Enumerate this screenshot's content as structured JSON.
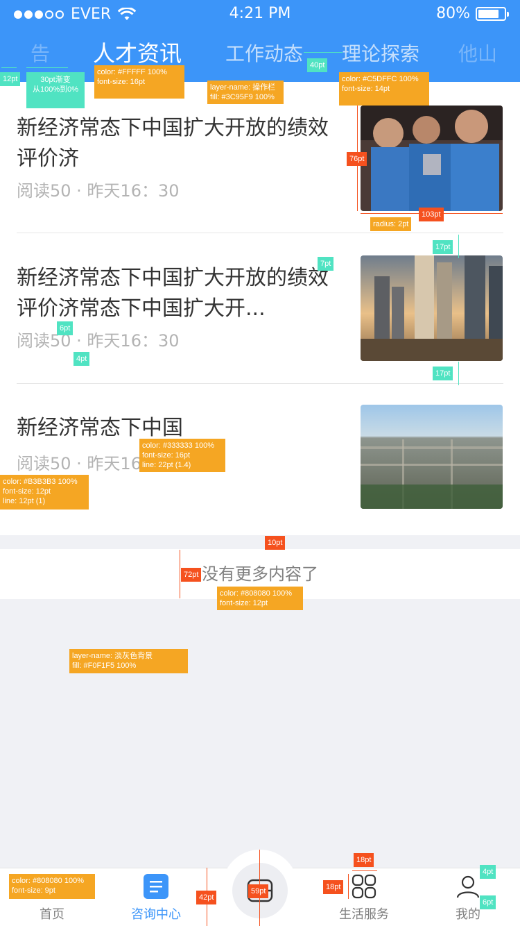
{
  "status_bar": {
    "carrier": "EVER",
    "time": "4:21 PM",
    "battery": "80%",
    "battery_level": 0.8
  },
  "tabs": [
    {
      "label": "告",
      "state": "partial"
    },
    {
      "label": "人才资讯",
      "state": "active"
    },
    {
      "label": "工作动态",
      "state": "normal"
    },
    {
      "label": "理论探索",
      "state": "normal"
    },
    {
      "label": "他山",
      "state": "partial"
    }
  ],
  "articles": [
    {
      "title": "新经济常态下中国扩大开放的绩效评价济",
      "meta": "阅读50 · 昨天16：30",
      "image": "basketball-photo"
    },
    {
      "title": "新经济常态下中国扩大开放的绩效评价济常态下中国扩大开...",
      "meta": "阅读50 · 昨天16：30",
      "image": "skyscraper-photo"
    },
    {
      "title": "新经济常态下中国",
      "meta": "阅读50 · 昨天16：30",
      "image": "city-aerial-photo"
    }
  ],
  "no_more_text": "没有更多内容了",
  "tabbar": {
    "items": [
      {
        "label": "首页",
        "icon": "home-icon",
        "active": false
      },
      {
        "label": "咨询中心",
        "icon": "list-icon",
        "active": true
      },
      {
        "label": "",
        "icon": "center-action-icon",
        "active": false
      },
      {
        "label": "生活服务",
        "icon": "grid-icon",
        "active": false
      },
      {
        "label": "我的",
        "icon": "user-icon",
        "active": false
      }
    ]
  },
  "colors": {
    "primary": "#3C95F9",
    "tab_inactive": "#C5DFFC",
    "title_text": "#333333",
    "meta_text": "#B3B3B3",
    "muted_text": "#808080",
    "page_bg": "#F0F1F5"
  },
  "annotations": {
    "a1": "12pt",
    "a2": "30pt渐变",
    "a2b": "从100%到0%",
    "a3": "color: #FFFFF 100%",
    "a3b": "font-size: 16pt",
    "a4": "layer-name: 操作栏",
    "a4b": "fill: #3C95F9 100%",
    "a5": "40pt",
    "a6": "color: #C5DFFC 100%",
    "a6b": "font-size: 14pt",
    "a7": "76pt",
    "a8": "103pt",
    "a9": "radius: 2pt",
    "a10": "17pt",
    "a11": "7pt",
    "a12": "6pt",
    "a13": "4pt",
    "a14": "17pt",
    "a15": "color: #333333 100%",
    "a15b": "font-size: 16pt",
    "a15c": "line: 22pt (1.4)",
    "a16": "color: #B3B3B3 100%",
    "a16b": "font-size: 12pt",
    "a16c": "line: 12pt (1)",
    "a17": "10pt",
    "a18": "72pt",
    "a19": "color: #808080 100%",
    "a19b": "font-size: 12pt",
    "a20": "layer-name: 淡灰色背景",
    "a20b": "fill: #F0F1F5 100%",
    "a21": "color: #808080 100%",
    "a21b": "font-size: 9pt",
    "a22": "42pt",
    "a23": "59pt",
    "a24": "18pt",
    "a25": "18pt",
    "a26": "4pt",
    "a27": "6pt"
  }
}
